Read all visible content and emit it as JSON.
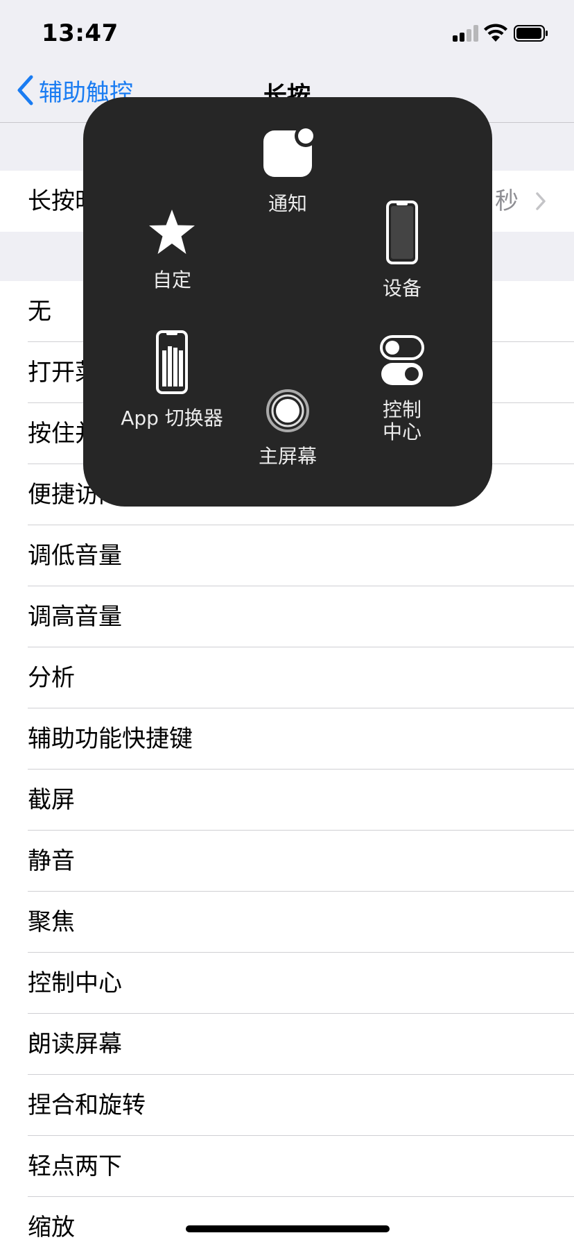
{
  "status_bar": {
    "time": "13:47",
    "signal_bars_active": 2,
    "signal_bars_total": 4
  },
  "nav": {
    "back_label": "辅助触控",
    "title": "长按"
  },
  "duration_cell": {
    "label": "长按时长",
    "value": "秒"
  },
  "options": [
    "无",
    "打开菜单",
    "按住并拖移",
    "便捷访问",
    "调低音量",
    "调高音量",
    "分析",
    "辅助功能快捷键",
    "截屏",
    "静音",
    "聚焦",
    "控制中心",
    "朗读屏幕",
    "捏合和旋转",
    "轻点两下",
    "缩放"
  ],
  "assistive_menu": {
    "notification": {
      "label": "通知",
      "icon": "notification-icon"
    },
    "custom": {
      "label": "自定",
      "icon": "star-icon"
    },
    "device": {
      "label": "设备",
      "icon": "iphone-device-icon"
    },
    "app_switcher": {
      "label": "App 切换器",
      "icon": "app-switcher-icon"
    },
    "home": {
      "label": "主屏幕",
      "icon": "home-button-icon"
    },
    "control_center": {
      "label": "控制\n中心",
      "icon": "toggle-switches-icon"
    }
  },
  "colors": {
    "accent": "#1a7cf2",
    "panel": "#262626",
    "background": "#efeff4"
  }
}
